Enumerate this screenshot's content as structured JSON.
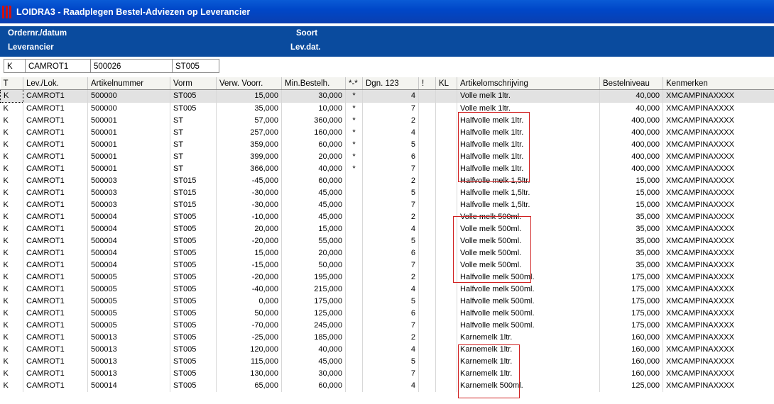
{
  "window": {
    "title": "LOIDRA3 - Raadplegen Bestel-Adviezen op Leverancier"
  },
  "header": {
    "order_label": "Ordernr./datum",
    "soort_label": "Soort",
    "leverancier_label": "Leverancier",
    "levdat_label": "Lev.dat."
  },
  "filter": [
    "K",
    "CAMROT1",
    "500026",
    "ST005"
  ],
  "columns": [
    "T",
    "Lev./Lok.",
    "Artikelnummer",
    "Vorm",
    "Verw. Voorr.",
    "Min.Bestelh.",
    "*-*",
    "Dgn. 123",
    "!",
    "KL",
    "Artikelomschrijving",
    "Bestelniveau",
    "Kenmerken"
  ],
  "rows": [
    [
      "K",
      "CAMROT1",
      "500000",
      "ST005",
      "15,000",
      "30,000",
      "*",
      "4",
      "",
      "",
      "Volle melk 1ltr.",
      "40,000",
      "XMCAMPINAXXXX"
    ],
    [
      "K",
      "CAMROT1",
      "500000",
      "ST005",
      "35,000",
      "10,000",
      "*",
      "7",
      "",
      "",
      "Volle melk 1ltr.",
      "40,000",
      "XMCAMPINAXXXX"
    ],
    [
      "K",
      "CAMROT1",
      "500001",
      "ST",
      "57,000",
      "360,000",
      "*",
      "2",
      "",
      "",
      "Halfvolle melk 1ltr.",
      "400,000",
      "XMCAMPINAXXXX"
    ],
    [
      "K",
      "CAMROT1",
      "500001",
      "ST",
      "257,000",
      "160,000",
      "*",
      "4",
      "",
      "",
      "Halfvolle melk 1ltr.",
      "400,000",
      "XMCAMPINAXXXX"
    ],
    [
      "K",
      "CAMROT1",
      "500001",
      "ST",
      "359,000",
      "60,000",
      "*",
      "5",
      "",
      "",
      "Halfvolle melk 1ltr.",
      "400,000",
      "XMCAMPINAXXXX"
    ],
    [
      "K",
      "CAMROT1",
      "500001",
      "ST",
      "399,000",
      "20,000",
      "*",
      "6",
      "",
      "",
      "Halfvolle melk 1ltr.",
      "400,000",
      "XMCAMPINAXXXX"
    ],
    [
      "K",
      "CAMROT1",
      "500001",
      "ST",
      "366,000",
      "40,000",
      "*",
      "7",
      "",
      "",
      "Halfvolle melk 1ltr.",
      "400,000",
      "XMCAMPINAXXXX"
    ],
    [
      "K",
      "CAMROT1",
      "500003",
      "ST015",
      "-45,000",
      "60,000",
      "",
      "2",
      "",
      "",
      "Halfvolle melk 1,5ltr.",
      "15,000",
      "XMCAMPINAXXXX"
    ],
    [
      "K",
      "CAMROT1",
      "500003",
      "ST015",
      "-30,000",
      "45,000",
      "",
      "5",
      "",
      "",
      "Halfvolle melk 1,5ltr.",
      "15,000",
      "XMCAMPINAXXXX"
    ],
    [
      "K",
      "CAMROT1",
      "500003",
      "ST015",
      "-30,000",
      "45,000",
      "",
      "7",
      "",
      "",
      "Halfvolle melk 1,5ltr.",
      "15,000",
      "XMCAMPINAXXXX"
    ],
    [
      "K",
      "CAMROT1",
      "500004",
      "ST005",
      "-10,000",
      "45,000",
      "",
      "2",
      "",
      "",
      "Volle melk 500ml.",
      "35,000",
      "XMCAMPINAXXXX"
    ],
    [
      "K",
      "CAMROT1",
      "500004",
      "ST005",
      "20,000",
      "15,000",
      "",
      "4",
      "",
      "",
      "Volle melk 500ml.",
      "35,000",
      "XMCAMPINAXXXX"
    ],
    [
      "K",
      "CAMROT1",
      "500004",
      "ST005",
      "-20,000",
      "55,000",
      "",
      "5",
      "",
      "",
      "Volle melk 500ml.",
      "35,000",
      "XMCAMPINAXXXX"
    ],
    [
      "K",
      "CAMROT1",
      "500004",
      "ST005",
      "15,000",
      "20,000",
      "",
      "6",
      "",
      "",
      "Volle melk 500ml.",
      "35,000",
      "XMCAMPINAXXXX"
    ],
    [
      "K",
      "CAMROT1",
      "500004",
      "ST005",
      "-15,000",
      "50,000",
      "",
      "7",
      "",
      "",
      "Volle melk 500ml.",
      "35,000",
      "XMCAMPINAXXXX"
    ],
    [
      "K",
      "CAMROT1",
      "500005",
      "ST005",
      "-20,000",
      "195,000",
      "",
      "2",
      "",
      "",
      "Halfvolle melk 500ml.",
      "175,000",
      "XMCAMPINAXXXX"
    ],
    [
      "K",
      "CAMROT1",
      "500005",
      "ST005",
      "-40,000",
      "215,000",
      "",
      "4",
      "",
      "",
      "Halfvolle melk 500ml.",
      "175,000",
      "XMCAMPINAXXXX"
    ],
    [
      "K",
      "CAMROT1",
      "500005",
      "ST005",
      "0,000",
      "175,000",
      "",
      "5",
      "",
      "",
      "Halfvolle melk 500ml.",
      "175,000",
      "XMCAMPINAXXXX"
    ],
    [
      "K",
      "CAMROT1",
      "500005",
      "ST005",
      "50,000",
      "125,000",
      "",
      "6",
      "",
      "",
      "Halfvolle melk 500ml.",
      "175,000",
      "XMCAMPINAXXXX"
    ],
    [
      "K",
      "CAMROT1",
      "500005",
      "ST005",
      "-70,000",
      "245,000",
      "",
      "7",
      "",
      "",
      "Halfvolle melk 500ml.",
      "175,000",
      "XMCAMPINAXXXX"
    ],
    [
      "K",
      "CAMROT1",
      "500013",
      "ST005",
      "-25,000",
      "185,000",
      "",
      "2",
      "",
      "",
      "Karnemelk 1ltr.",
      "160,000",
      "XMCAMPINAXXXX"
    ],
    [
      "K",
      "CAMROT1",
      "500013",
      "ST005",
      "120,000",
      "40,000",
      "",
      "4",
      "",
      "",
      "Karnemelk 1ltr.",
      "160,000",
      "XMCAMPINAXXXX"
    ],
    [
      "K",
      "CAMROT1",
      "500013",
      "ST005",
      "115,000",
      "45,000",
      "",
      "5",
      "",
      "",
      "Karnemelk 1ltr.",
      "160,000",
      "XMCAMPINAXXXX"
    ],
    [
      "K",
      "CAMROT1",
      "500013",
      "ST005",
      "130,000",
      "30,000",
      "",
      "7",
      "",
      "",
      "Karnemelk 1ltr.",
      "160,000",
      "XMCAMPINAXXXX"
    ],
    [
      "K",
      "CAMROT1",
      "500014",
      "ST005",
      "65,000",
      "60,000",
      "",
      "4",
      "",
      "",
      "Karnemelk 500ml.",
      "125,000",
      "XMCAMPINAXXXX"
    ]
  ]
}
